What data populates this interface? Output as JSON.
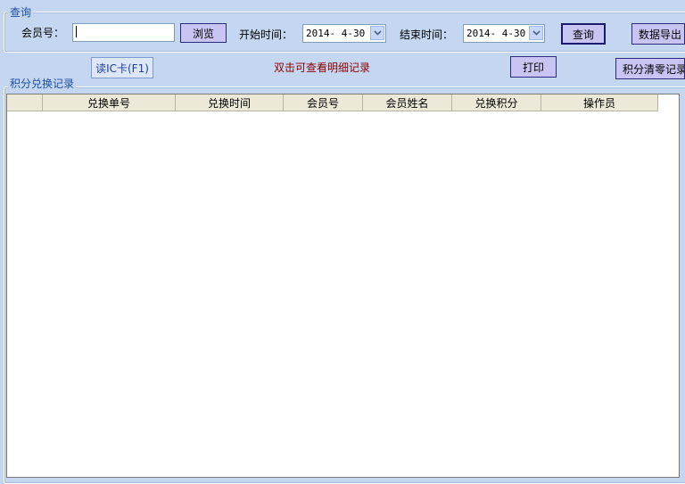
{
  "query_group": {
    "legend": "查询",
    "member_label": "会员号：",
    "member_value": "",
    "browse_button": "浏览",
    "start_label": "开始时间：",
    "start_value": "2014- 4-30",
    "end_label": "结束时间：",
    "end_value": "2014- 4-30",
    "query_button": "查询",
    "export_button": "数据导出"
  },
  "toolbar": {
    "read_card_button": "读IC卡(F1)",
    "hint": "双击可查看明细记录",
    "print_button": "打印",
    "clear_button": "积分清零记录"
  },
  "records_group": {
    "legend": "积分兑换记录",
    "columns": [
      "兑换单号",
      "兑换时间",
      "会员号",
      "会员姓名",
      "兑换积分",
      "操作员"
    ]
  },
  "colors": {
    "background": "#c5d7f0",
    "legend_text": "#1d4fa6",
    "hint_text": "#8b0000",
    "button_fill": "#c9c5f2"
  }
}
